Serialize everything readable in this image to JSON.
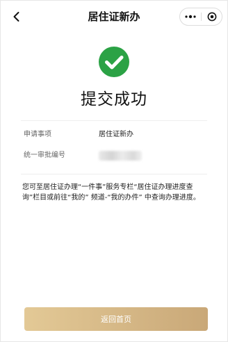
{
  "header": {
    "title": "居住证新办",
    "back_icon": "chevron-left-icon",
    "more_icon": "more-dots-icon",
    "close_icon": "target-icon"
  },
  "result": {
    "icon": "check-circle-icon",
    "icon_color": "#2ba245",
    "title": "提交成功"
  },
  "info": {
    "rows": [
      {
        "label": "申请事项",
        "value": "居住证新办"
      },
      {
        "label": "统一审批编号",
        "value": ""
      }
    ]
  },
  "notice": "您可至居住证办理“一件事”服务专栏“居住证办理进度查询”栏目或前往“我的” 频道-“我的办件” 中查询办理进度。",
  "footer": {
    "home_button_label": "返回首页",
    "button_gradient_start": "#e3c996",
    "button_gradient_end": "#c9a878"
  }
}
